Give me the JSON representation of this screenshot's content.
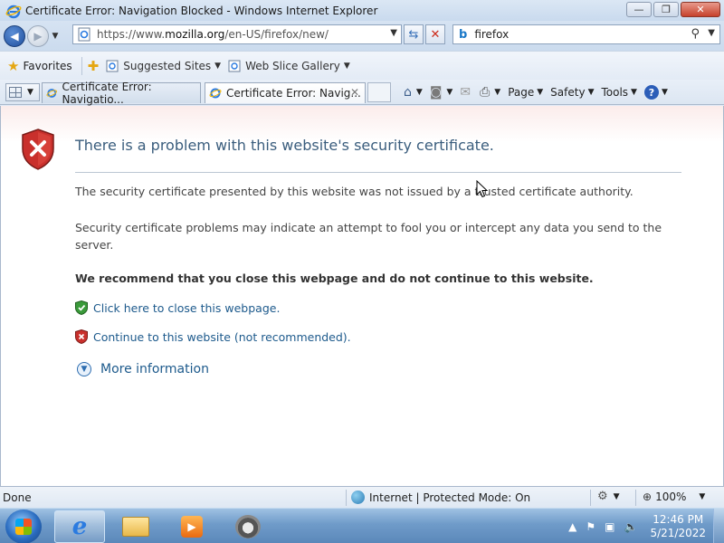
{
  "window": {
    "title": "Certificate Error: Navigation Blocked - Windows Internet Explorer",
    "min": "—",
    "max": "❐",
    "close": "✕"
  },
  "address": {
    "url_prefix": "https://www.",
    "url_domain": "mozilla.org",
    "url_path": "/en-US/firefox/new/",
    "search_value": "firefox",
    "refresh_icon": "refresh-icon",
    "stop_icon": "stop-icon"
  },
  "favorites": {
    "favorites_label": "Favorites",
    "suggested_sites": "Suggested Sites",
    "web_slice_gallery": "Web Slice Gallery"
  },
  "tabs": [
    {
      "label": "Certificate Error: Navigatio...",
      "active": false
    },
    {
      "label": "Certificate Error: Navig...",
      "active": true
    }
  ],
  "command_bar": {
    "page": "Page",
    "safety": "Safety",
    "tools": "Tools",
    "help": "?"
  },
  "content": {
    "headline": "There is a problem with this website's security certificate.",
    "p1": "The security certificate presented by this website was not issued by a trusted certificate authority.",
    "p2": "Security certificate problems may indicate an attempt to fool you or intercept any data you send to the server.",
    "recommend": "We recommend that you close this webpage and do not continue to this website.",
    "close_link": "Click here to close this webpage.",
    "continue_link": "Continue to this website (not recommended).",
    "more_info": "More information"
  },
  "status": {
    "text": "Done",
    "zone": "Internet | Protected Mode: On",
    "zoom": "100%"
  },
  "taskbar": {
    "time": "12:46 PM",
    "date": "5/21/2022"
  },
  "colors": {
    "accent": "#1d5a8c",
    "headline": "#3a5d7d",
    "error_red": "#c62828",
    "ok_green": "#3a9a3a"
  }
}
